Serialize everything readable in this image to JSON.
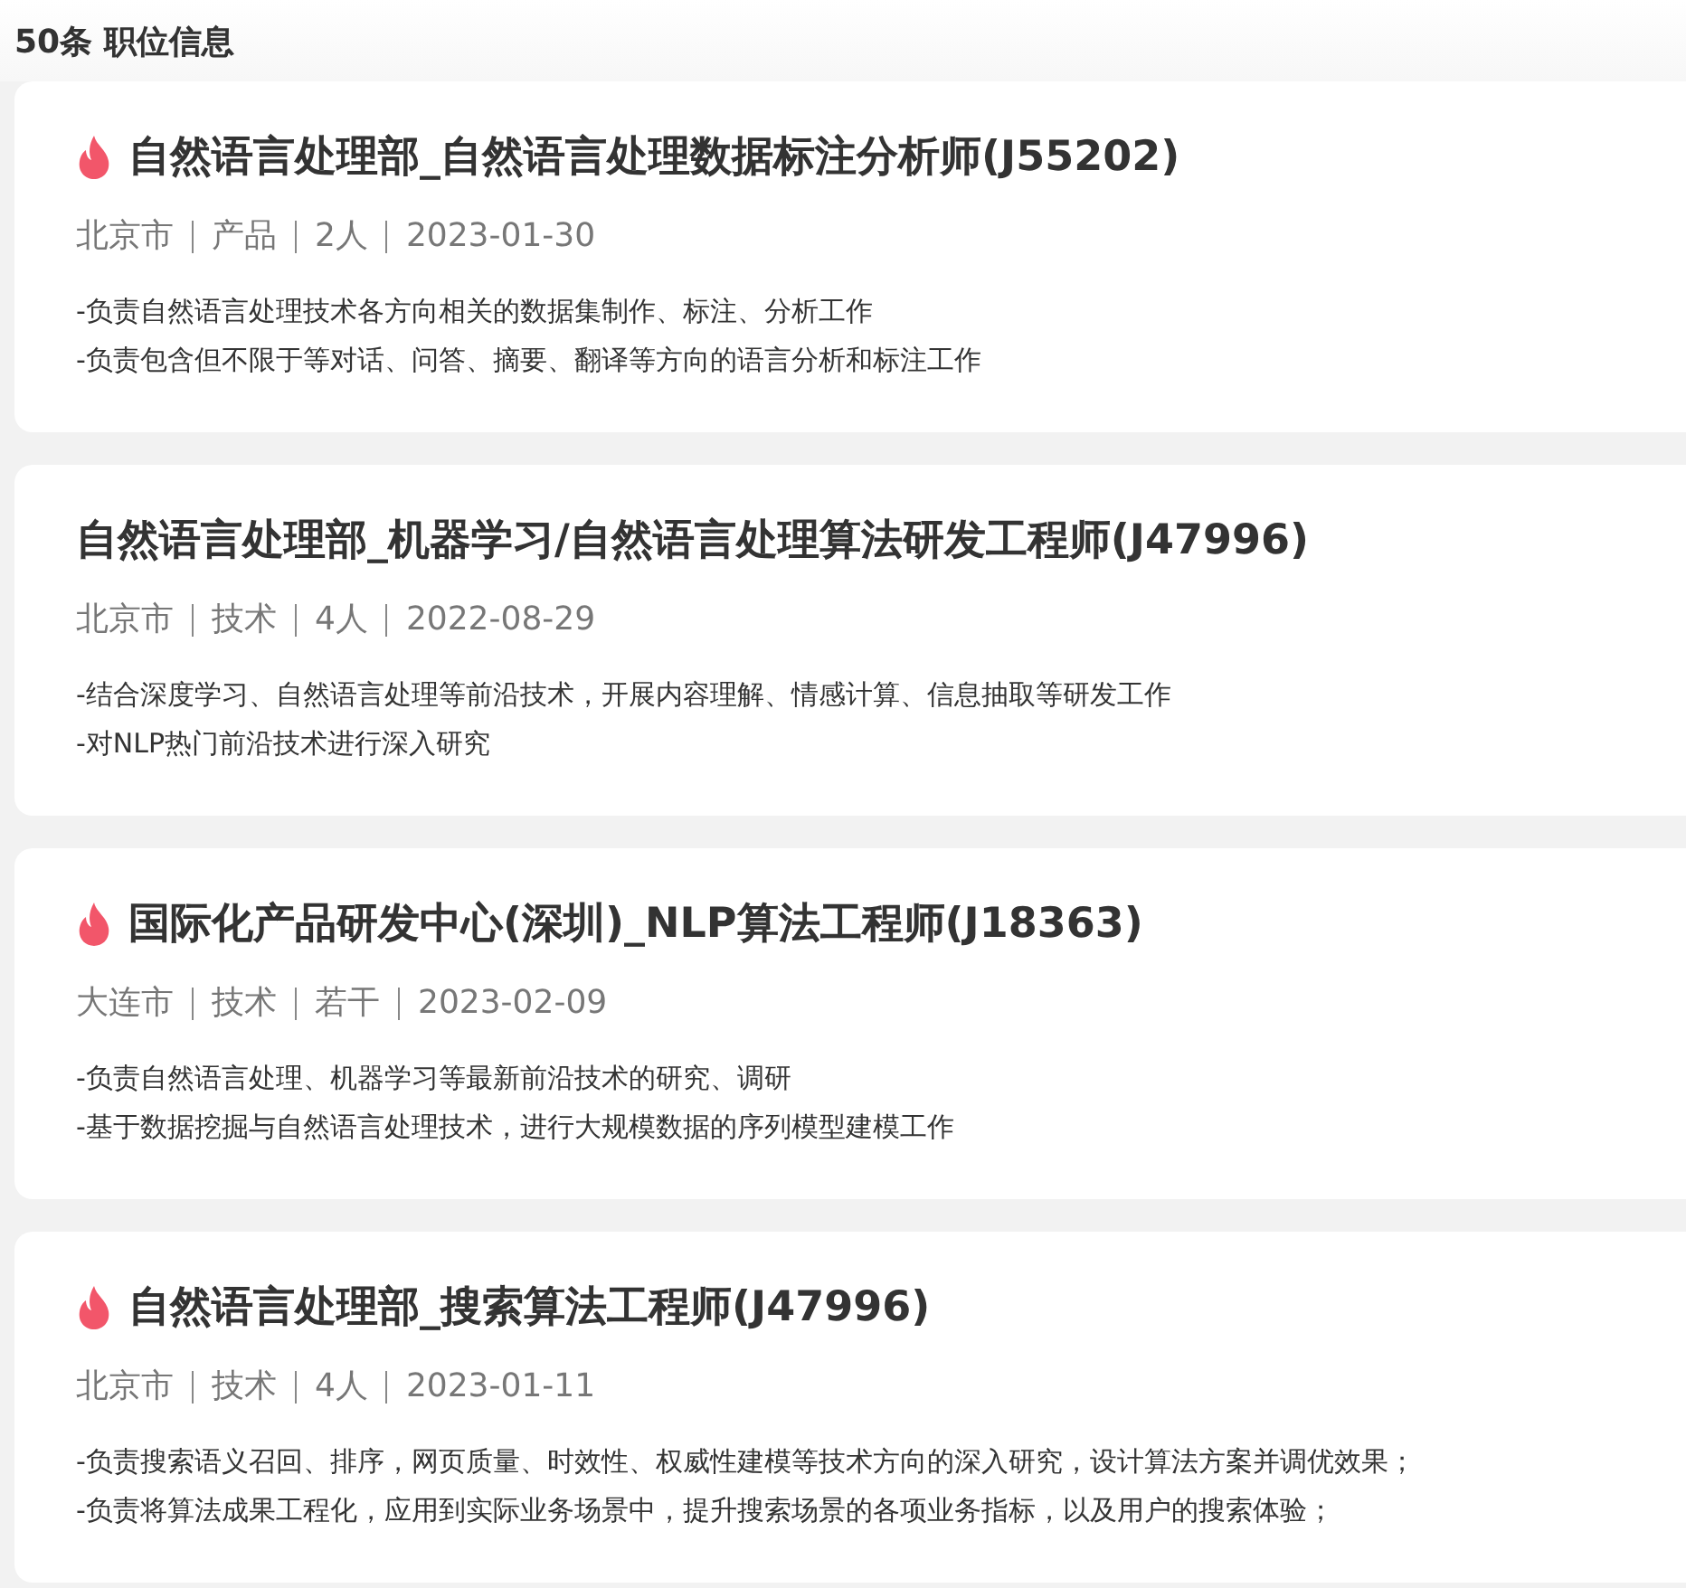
{
  "header": {
    "title": "50条 职位信息"
  },
  "jobs": [
    {
      "hot": true,
      "title": "自然语言处理部_自然语言处理数据标注分析师(J55202)",
      "meta": [
        "北京市",
        "产品",
        "2人",
        "2023-01-30"
      ],
      "duties": [
        "-负责自然语言处理技术各方向相关的数据集制作、标注、分析工作",
        "-负责包含但不限于等对话、问答、摘要、翻译等方向的语言分析和标注工作"
      ]
    },
    {
      "hot": false,
      "title": "自然语言处理部_机器学习/自然语言处理算法研发工程师(J47996)",
      "meta": [
        "北京市",
        "技术",
        "4人",
        "2022-08-29"
      ],
      "duties": [
        "-结合深度学习、自然语言处理等前沿技术，开展内容理解、情感计算、信息抽取等研发工作",
        "-对NLP热门前沿技术进行深入研究"
      ]
    },
    {
      "hot": true,
      "title": "国际化产品研发中心(深圳)_NLP算法工程师(J18363)",
      "meta": [
        "大连市",
        "技术",
        "若干",
        "2023-02-09"
      ],
      "duties": [
        "-负责自然语言处理、机器学习等最新前沿技术的研究、调研",
        "-基于数据挖掘与自然语言处理技术，进行大规模数据的序列模型建模工作"
      ]
    },
    {
      "hot": true,
      "title": "自然语言处理部_搜索算法工程师(J47996)",
      "meta": [
        "北京市",
        "技术",
        "4人",
        "2023-01-11"
      ],
      "duties": [
        "-负责搜索语义召回、排序，网页质量、时效性、权威性建模等技术方向的深入研究，设计算法方案并调优效果；",
        "-负责将算法成果工程化，应用到实际业务场景中，提升搜索场景的各项业务指标，以及用户的搜索体验；"
      ]
    }
  ]
}
